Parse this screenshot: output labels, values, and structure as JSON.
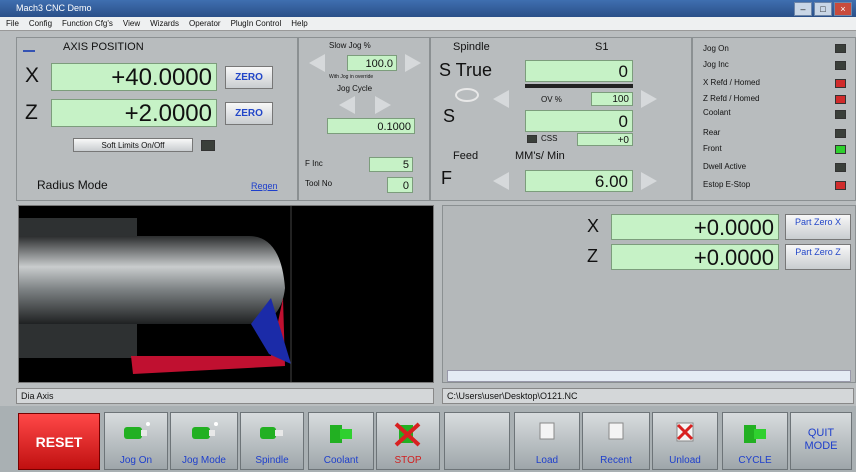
{
  "window": {
    "title": "Mach3 CNC Demo"
  },
  "menu": {
    "items": [
      "File",
      "Config",
      "Function Cfg's",
      "View",
      "Wizards",
      "Operator",
      "PlugIn Control",
      "Help"
    ]
  },
  "axis_panel": {
    "title": "AXIS POSITION",
    "x_label": "X",
    "x_value": "+40.0000",
    "x_zero": "ZERO",
    "z_label": "Z",
    "z_value": "+2.0000",
    "z_zero": "ZERO",
    "soft_limits": "Soft Limits On/Off",
    "mode": "Radius Mode",
    "regen": "Regen"
  },
  "jog_panel": {
    "slow_jog_label": "Slow Jog %",
    "slow_jog_value": "100.0",
    "slow_jog_note": "With Jog in override",
    "jog_cycle_label": "Jog Cycle",
    "jog_cycle_value": "0.1000",
    "f_inc_label": "F Inc",
    "f_inc_value": "5",
    "tool_no_label": "Tool No",
    "tool_no_value": "0"
  },
  "spindle_panel": {
    "title": "Spindle",
    "s_channel": "S1",
    "s_true_label": "S True",
    "s_true_value": "0",
    "ov_label": "OV %",
    "ov_value": "100",
    "s_label": "S",
    "s_value": "0",
    "css_label": "CSS",
    "css_value": "+0",
    "feed_label": "Feed",
    "feed_units": "MM's/ Min",
    "f_label": "F",
    "f_value": "6.00"
  },
  "status_panel": {
    "items": [
      {
        "label": "Jog On",
        "color": "#3a3f3a"
      },
      {
        "label": "Jog Inc",
        "color": "#3a3f3a"
      },
      {
        "label": "X Refd / Homed",
        "color": "#d02b2b"
      },
      {
        "label": "Z Refd / Homed",
        "color": "#d02b2b"
      },
      {
        "label": "Coolant",
        "color": "#3a3f3a"
      },
      {
        "label": "Rear",
        "color": "#3a3f3a"
      },
      {
        "label": "Front",
        "color": "#2ed02e"
      },
      {
        "label": "Dwell Active",
        "color": "#3a3f3a"
      },
      {
        "label": "Estop E-Stop",
        "color": "#d02b2b"
      }
    ]
  },
  "part_zero": {
    "x_label": "X",
    "x_value": "+0.0000",
    "x_btn": "Part Zero X",
    "z_label": "Z",
    "z_value": "+0.0000",
    "z_btn": "Part Zero Z"
  },
  "status_bar": {
    "left": "Dia Axis",
    "right": "C:\\Users\\user\\Desktop\\O121.NC"
  },
  "toolbar": {
    "reset": "RESET",
    "jog_on": "Jog On",
    "jog_mode": "Jog Mode",
    "spindle": "Spindle",
    "coolant": "Coolant",
    "stop": "STOP",
    "load": "Load",
    "recent": "Recent",
    "unload": "Unload",
    "cycle": "CYCLE",
    "quit_mode": "QUIT MODE"
  }
}
